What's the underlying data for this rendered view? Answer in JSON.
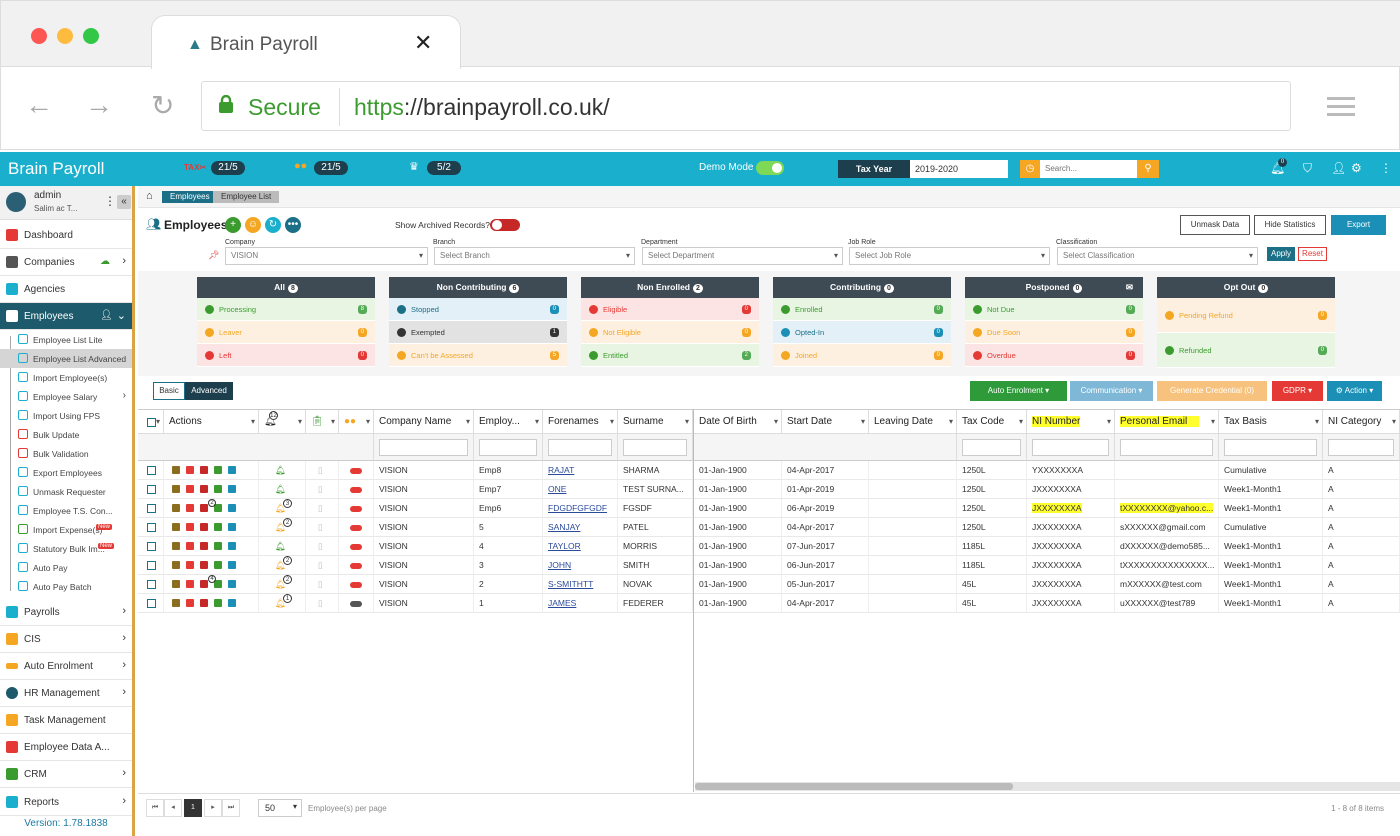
{
  "browser": {
    "tab_title": "Brain Payroll",
    "secure_label": "Secure",
    "url_scheme": "https",
    "url_rest": "://brainpayroll.co.uk/"
  },
  "header": {
    "brand": "Brain Payroll",
    "counter1": "21/5",
    "counter2": "21/5",
    "counter3": "5/2",
    "demo_mode": "Demo Mode",
    "demo_toggle": "On",
    "tax_year_label": "Tax Year",
    "tax_year_value": "2019-2020",
    "search_placeholder": "Search...",
    "notif_count": "0"
  },
  "sidebar": {
    "user_name": "admin",
    "user_sub": "Salim ac T...",
    "menu": [
      {
        "label": "Dashboard"
      },
      {
        "label": "Companies"
      },
      {
        "label": "Agencies"
      },
      {
        "label": "Employees"
      },
      {
        "label": "Payrolls"
      },
      {
        "label": "CIS"
      },
      {
        "label": "Auto Enrolment"
      },
      {
        "label": "HR Management"
      },
      {
        "label": "Task Management"
      },
      {
        "label": "Employee Data A..."
      },
      {
        "label": "CRM"
      },
      {
        "label": "Reports"
      }
    ],
    "submenu": [
      {
        "label": "Employee List Lite"
      },
      {
        "label": "Employee List Advanced"
      },
      {
        "label": "Import Employee(s)"
      },
      {
        "label": "Employee Salary"
      },
      {
        "label": "Import Using FPS"
      },
      {
        "label": "Bulk Update"
      },
      {
        "label": "Bulk Validation"
      },
      {
        "label": "Export Employees"
      },
      {
        "label": "Unmask Requester"
      },
      {
        "label": "Employee T.S. Con..."
      },
      {
        "label": "Import Expense(s)"
      },
      {
        "label": "Statutory Bulk Im..."
      },
      {
        "label": "Auto Pay"
      },
      {
        "label": "Auto Pay Batch"
      }
    ],
    "new_badge": "New",
    "version": "Version: 1.78.1838"
  },
  "main": {
    "breadcrumb": [
      "Employees",
      "Employee List"
    ],
    "title": "Employees",
    "show_archived": "Show Archived Records?",
    "unmask_btn": "Unmask Data",
    "hide_stats_btn": "Hide Statistics",
    "export_btn": "Export",
    "filters": {
      "company_label": "Company",
      "company_value": "VISION",
      "branch_label": "Branch",
      "branch_value": "Select Branch",
      "department_label": "Department",
      "department_value": "Select Department",
      "jobrole_label": "Job Role",
      "jobrole_value": "Select Job Role",
      "classification_label": "Classification",
      "classification_value": "Select Classification",
      "apply": "Apply",
      "reset": "Reset"
    },
    "stats": [
      {
        "title": "All",
        "count": "8",
        "rows": [
          {
            "label": "Processing",
            "count": "8"
          },
          {
            "label": "Leaver",
            "count": "0"
          },
          {
            "label": "Left",
            "count": "0"
          }
        ]
      },
      {
        "title": "Non Contributing",
        "count": "6",
        "rows": [
          {
            "label": "Stopped",
            "count": "0"
          },
          {
            "label": "Exempted",
            "count": "1"
          },
          {
            "label": "Can't be Assessed",
            "count": "5"
          }
        ]
      },
      {
        "title": "Non Enrolled",
        "count": "2",
        "rows": [
          {
            "label": "Eligible",
            "count": "0"
          },
          {
            "label": "Not Eligible",
            "count": "0"
          },
          {
            "label": "Entitled",
            "count": "2"
          }
        ]
      },
      {
        "title": "Contributing",
        "count": "0",
        "rows": [
          {
            "label": "Enrolled",
            "count": "0"
          },
          {
            "label": "Opted-In",
            "count": "0"
          },
          {
            "label": "Joined",
            "count": "0"
          }
        ]
      },
      {
        "title": "Postponed",
        "count": "0",
        "rows": [
          {
            "label": "Not Due",
            "count": "0"
          },
          {
            "label": "Due Soon",
            "count": "0"
          },
          {
            "label": "Overdue",
            "count": "0"
          }
        ]
      },
      {
        "title": "Opt Out",
        "count": "0",
        "rows": [
          {
            "label": "Pending Refund",
            "count": "0"
          },
          {
            "label": "Refunded",
            "count": "0"
          }
        ]
      }
    ],
    "view_basic": "Basic",
    "view_advanced": "Advanced",
    "actions": {
      "auto_enrolment": "Auto Enrolment",
      "communication": "Communication",
      "generate_credential": "Generate Credential",
      "generate_credential_count": "(0)",
      "gdpr": "GDPR",
      "action": "Action"
    },
    "bell_count": "12",
    "columns": [
      "Actions",
      "Company Name",
      "Employ...",
      "Forenames",
      "Surname",
      "Date Of Birth",
      "Start Date",
      "Leaving Date",
      "Tax Code",
      "NI Number",
      "Personal Email",
      "Tax Basis",
      "NI Category"
    ],
    "rows": [
      {
        "company": "VISION",
        "emp": "Emp8",
        "forenames": "RAJAT",
        "surname": "SHARMA",
        "dob": "01-Jan-1900",
        "start": "04-Apr-2017",
        "leaving": "",
        "tax": "1250L",
        "ni": "YXXXXXXXA",
        "email": "",
        "basis": "Cumulative",
        "nicat": "A",
        "bell": "",
        "gavel": ""
      },
      {
        "company": "VISION",
        "emp": "Emp7",
        "forenames": "ONE",
        "surname": "TEST SURNA...",
        "dob": "01-Jan-1900",
        "start": "01-Apr-2019",
        "leaving": "",
        "tax": "1250L",
        "ni": "JXXXXXXXA",
        "email": "",
        "basis": "Week1-Month1",
        "nicat": "A",
        "bell": "",
        "gavel": ""
      },
      {
        "company": "VISION",
        "emp": "Emp6",
        "forenames": "FDGDFGFGDF",
        "surname": "FGSDF",
        "dob": "01-Jan-1900",
        "start": "06-Apr-2019",
        "leaving": "",
        "tax": "1250L",
        "ni": "JXXXXXXXA",
        "email": "tXXXXXXXX@yahoo.c...",
        "basis": "Week1-Month1",
        "nicat": "A",
        "bell": "3",
        "gavel": "2"
      },
      {
        "company": "VISION",
        "emp": "5",
        "forenames": "SANJAY",
        "surname": "PATEL",
        "dob": "01-Jan-1900",
        "start": "04-Apr-2017",
        "leaving": "",
        "tax": "1250L",
        "ni": "JXXXXXXXA",
        "email": "sXXXXXX@gmail.com",
        "basis": "Cumulative",
        "nicat": "A",
        "bell": "2",
        "gavel": ""
      },
      {
        "company": "VISION",
        "emp": "4",
        "forenames": "TAYLOR",
        "surname": "MORRIS",
        "dob": "01-Jan-1900",
        "start": "07-Jun-2017",
        "leaving": "",
        "tax": "1185L",
        "ni": "JXXXXXXXA",
        "email": "dXXXXXX@demo585...",
        "basis": "Week1-Month1",
        "nicat": "A",
        "bell": "",
        "gavel": ""
      },
      {
        "company": "VISION",
        "emp": "3",
        "forenames": "JOHN",
        "surname": "SMITH",
        "dob": "01-Jan-1900",
        "start": "06-Jun-2017",
        "leaving": "",
        "tax": "1185L",
        "ni": "JXXXXXXXA",
        "email": "tXXXXXXXXXXXXXXX...",
        "basis": "Week1-Month1",
        "nicat": "A",
        "bell": "2",
        "gavel": ""
      },
      {
        "company": "VISION",
        "emp": "2",
        "forenames": "S-SMITHTT",
        "surname": "NOVAK",
        "dob": "01-Jan-1900",
        "start": "05-Jun-2017",
        "leaving": "",
        "tax": "45L",
        "ni": "JXXXXXXXA",
        "email": "mXXXXXX@test.com",
        "basis": "Week1-Month1",
        "nicat": "A",
        "bell": "2",
        "gavel": "4"
      },
      {
        "company": "VISION",
        "emp": "1",
        "forenames": "JAMES",
        "surname": "FEDERER",
        "dob": "01-Jan-1900",
        "start": "04-Apr-2017",
        "leaving": "",
        "tax": "45L",
        "ni": "JXXXXXXXA",
        "email": "uXXXXXX@test789",
        "basis": "Week1-Month1",
        "nicat": "A",
        "bell": "1",
        "gavel": ""
      }
    ],
    "footer": {
      "page": "1",
      "per_page": "50",
      "per_page_label": "Employee(s) per page",
      "items": "1 - 8 of 8 items"
    }
  },
  "colors": {
    "header": "#1ab0cd",
    "dark": "#1d3f4d",
    "accent": "#f5a623",
    "highlight": "#ffff2e"
  }
}
